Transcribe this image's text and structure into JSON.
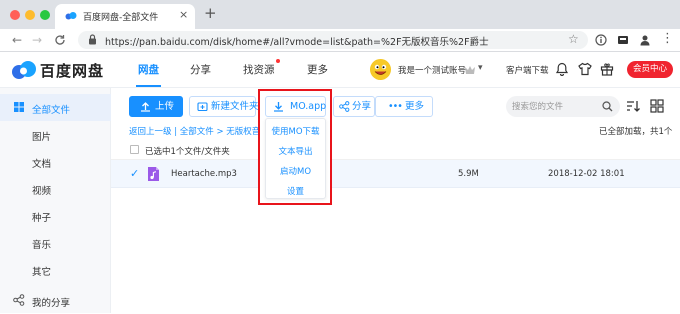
{
  "browser": {
    "tab_title": "百度网盘-全部文件",
    "tab_close": "×",
    "new_tab": "+",
    "url": "https://pan.baidu.com/disk/home#/all?vmode=list&path=%2F无版权音乐%2F爵士",
    "nav": {
      "back": "←",
      "forward": "→",
      "reload": "C"
    },
    "star": "☆"
  },
  "header": {
    "logo_text": "百度网盘",
    "nav_items": [
      "网盘",
      "分享",
      "找资源",
      "更多"
    ],
    "active_nav": "网盘",
    "account_name": "我是一个测试账号",
    "account_chevron": "▾",
    "client_download": "客户端下载",
    "vip_button": "会员中心",
    "icons": [
      "bell-icon",
      "shirt-icon",
      "gift-icon"
    ]
  },
  "sidebar": {
    "items": [
      {
        "label": "全部文件",
        "icon": "files-icon"
      },
      {
        "label": "图片"
      },
      {
        "label": "文档"
      },
      {
        "label": "视频"
      },
      {
        "label": "种子"
      },
      {
        "label": "音乐"
      },
      {
        "label": "其它"
      },
      {
        "label": "我的分享",
        "icon": "share-icon"
      }
    ],
    "active": "全部文件"
  },
  "toolbar": {
    "upload": "上传",
    "new_folder": "新建文件夹",
    "mo_app": "MO.app",
    "share": "分享",
    "more": "更多",
    "search_placeholder": "搜索您的文件"
  },
  "mo_menu": {
    "items": [
      "使用MO下载",
      "文本导出",
      "启动MO",
      "设置"
    ]
  },
  "breadcrumb": {
    "text": "返回上一级 | 全部文件 > 无版权音乐 > 爵"
  },
  "status": {
    "loaded": "已全部加载，共1个",
    "selection": "已选中1个文件/文件夹"
  },
  "files": [
    {
      "name": "Heartache.mp3",
      "size": "5.9M",
      "date": "2018-12-02 18:01",
      "selected": true,
      "check": "✓"
    }
  ],
  "colors": {
    "brand_blue": "#1890ff",
    "vip_red": "#f0242f",
    "highlight_red": "#e8141b"
  }
}
